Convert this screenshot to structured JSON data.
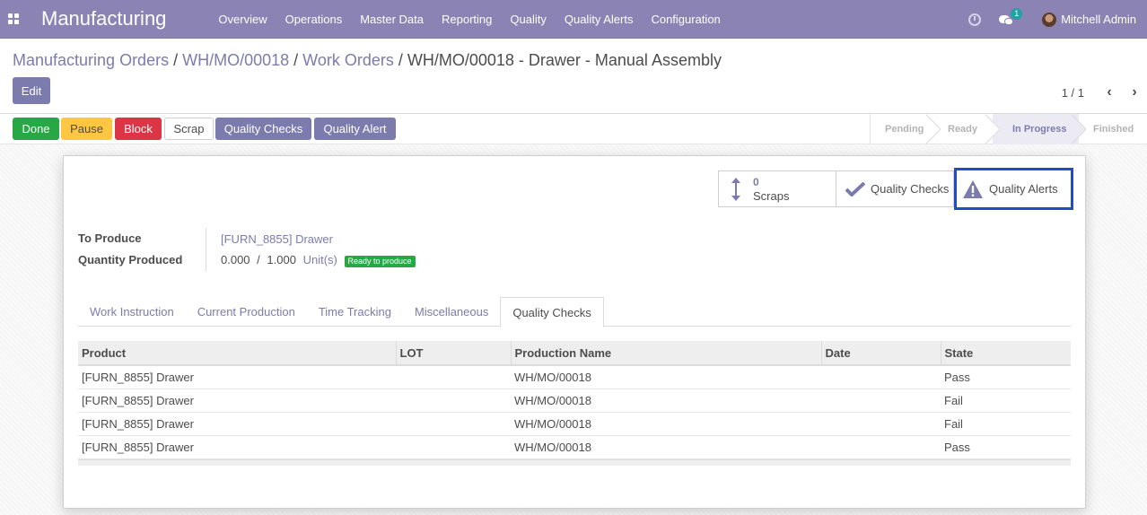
{
  "navbar": {
    "app_name": "Manufacturing",
    "menu": [
      "Overview",
      "Operations",
      "Master Data",
      "Reporting",
      "Quality",
      "Quality Alerts",
      "Configuration"
    ],
    "chat_count": "1",
    "user_name": "Mitchell Admin"
  },
  "breadcrumb": {
    "items": [
      "Manufacturing Orders",
      "WH/MO/00018",
      "Work Orders"
    ],
    "current": "WH/MO/00018 - Drawer - Manual Assembly"
  },
  "control": {
    "edit_label": "Edit",
    "pager": "1 / 1"
  },
  "actions": {
    "done": "Done",
    "pause": "Pause",
    "block": "Block",
    "scrap": "Scrap",
    "quality_checks": "Quality Checks",
    "quality_alert": "Quality Alert"
  },
  "stages": [
    "Pending",
    "Ready",
    "In Progress",
    "Finished"
  ],
  "active_stage": "In Progress",
  "smart_buttons": {
    "scraps_count": "0",
    "scraps_label": "Scraps",
    "quality_checks": "Quality Checks",
    "quality_alerts": "Quality Alerts"
  },
  "form": {
    "to_produce_label": "To Produce",
    "to_produce_value": "[FURN_8855] Drawer",
    "qty_label": "Quantity Produced",
    "qty_produced": "0.000",
    "qty_sep": "/",
    "qty_total": "1.000",
    "qty_unit": "Unit(s)",
    "status_badge": "Ready to produce"
  },
  "tabs": [
    "Work Instruction",
    "Current Production",
    "Time Tracking",
    "Miscellaneous",
    "Quality Checks"
  ],
  "active_tab": "Quality Checks",
  "table": {
    "headers": [
      "Product",
      "LOT",
      "Production Name",
      "Date",
      "State"
    ],
    "rows": [
      [
        "[FURN_8855] Drawer",
        "",
        "WH/MO/00018",
        "",
        "Pass"
      ],
      [
        "[FURN_8855] Drawer",
        "",
        "WH/MO/00018",
        "",
        "Fail"
      ],
      [
        "[FURN_8855] Drawer",
        "",
        "WH/MO/00018",
        "",
        "Fail"
      ],
      [
        "[FURN_8855] Drawer",
        "",
        "WH/MO/00018",
        "",
        "Pass"
      ]
    ]
  },
  "colors": {
    "brand": "#8b83b3",
    "accent": "#7c7bad",
    "success": "#28a745",
    "warning": "#ffc641",
    "danger": "#dc3545",
    "highlight": "#1f4ec2"
  }
}
